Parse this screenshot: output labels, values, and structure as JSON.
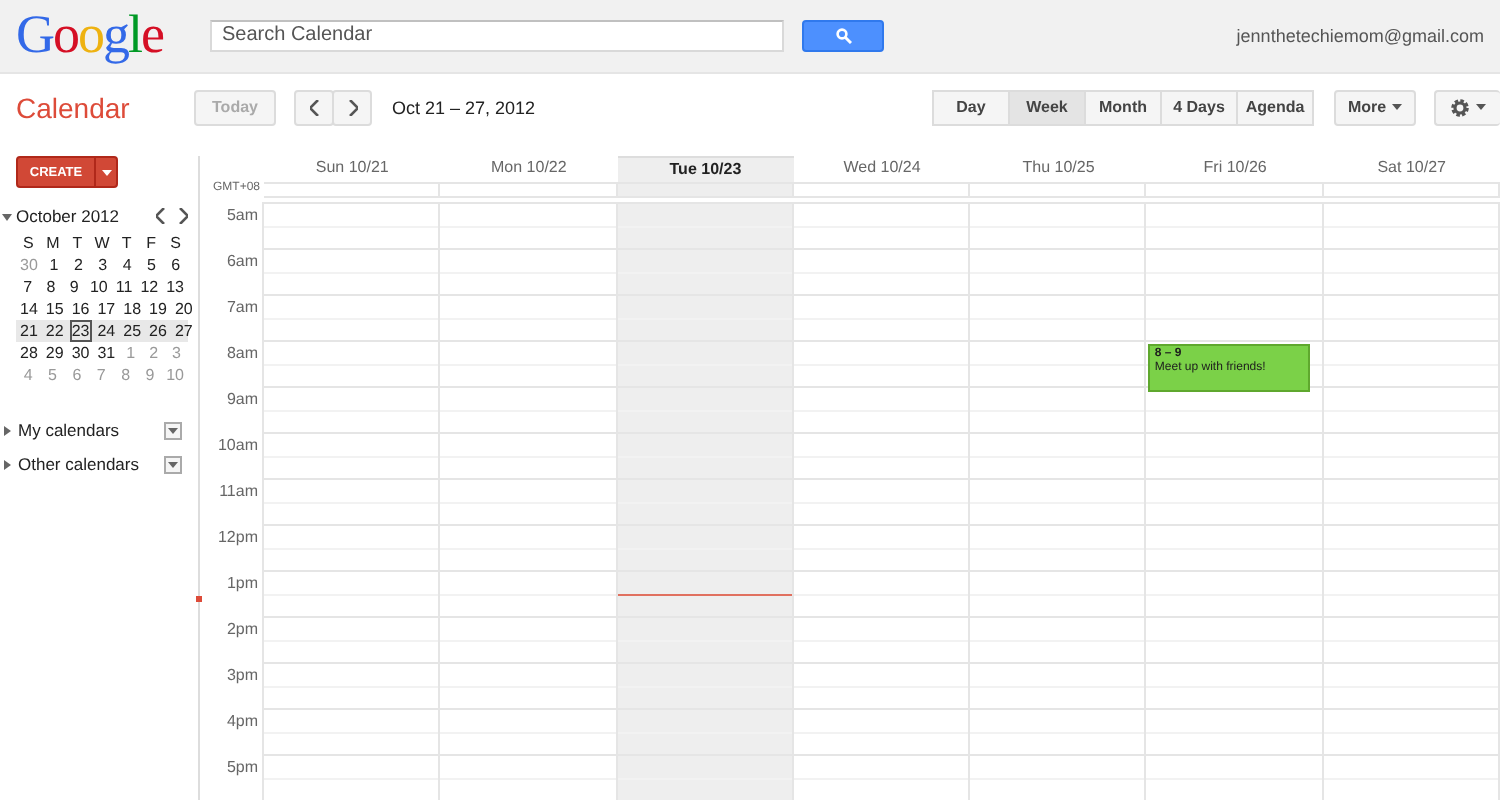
{
  "header": {
    "logo": "Google",
    "search": {
      "placeholder": "Search Calendar"
    },
    "account": "jennthetechiemom@gmail.com"
  },
  "toolbar": {
    "app_title": "Calendar",
    "today_button": {
      "label": "Today",
      "disabled": true
    },
    "date_range": "Oct 21 – 27, 2012",
    "views": [
      {
        "label": "Day",
        "selected": false
      },
      {
        "label": "Week",
        "selected": true
      },
      {
        "label": "Month",
        "selected": false
      },
      {
        "label": "4 Days",
        "selected": false
      },
      {
        "label": "Agenda",
        "selected": false
      }
    ],
    "more_button": "More"
  },
  "sidebar": {
    "create_button": "CREATE",
    "mini_calendar": {
      "title": "October 2012",
      "weekdays": [
        "S",
        "M",
        "T",
        "W",
        "T",
        "F",
        "S"
      ],
      "weeks": [
        {
          "selected": false,
          "days": [
            {
              "label": "30",
              "other_month": true,
              "today": false
            },
            {
              "label": "1",
              "other_month": false,
              "today": false
            },
            {
              "label": "2",
              "other_month": false,
              "today": false
            },
            {
              "label": "3",
              "other_month": false,
              "today": false
            },
            {
              "label": "4",
              "other_month": false,
              "today": false
            },
            {
              "label": "5",
              "other_month": false,
              "today": false
            },
            {
              "label": "6",
              "other_month": false,
              "today": false
            }
          ]
        },
        {
          "selected": false,
          "days": [
            {
              "label": "7",
              "other_month": false,
              "today": false
            },
            {
              "label": "8",
              "other_month": false,
              "today": false
            },
            {
              "label": "9",
              "other_month": false,
              "today": false
            },
            {
              "label": "10",
              "other_month": false,
              "today": false
            },
            {
              "label": "11",
              "other_month": false,
              "today": false
            },
            {
              "label": "12",
              "other_month": false,
              "today": false
            },
            {
              "label": "13",
              "other_month": false,
              "today": false
            }
          ]
        },
        {
          "selected": false,
          "days": [
            {
              "label": "14",
              "other_month": false,
              "today": false
            },
            {
              "label": "15",
              "other_month": false,
              "today": false
            },
            {
              "label": "16",
              "other_month": false,
              "today": false
            },
            {
              "label": "17",
              "other_month": false,
              "today": false
            },
            {
              "label": "18",
              "other_month": false,
              "today": false
            },
            {
              "label": "19",
              "other_month": false,
              "today": false
            },
            {
              "label": "20",
              "other_month": false,
              "today": false
            }
          ]
        },
        {
          "selected": true,
          "days": [
            {
              "label": "21",
              "other_month": false,
              "today": false
            },
            {
              "label": "22",
              "other_month": false,
              "today": false
            },
            {
              "label": "23",
              "other_month": false,
              "today": true
            },
            {
              "label": "24",
              "other_month": false,
              "today": false
            },
            {
              "label": "25",
              "other_month": false,
              "today": false
            },
            {
              "label": "26",
              "other_month": false,
              "today": false
            },
            {
              "label": "27",
              "other_month": false,
              "today": false
            }
          ]
        },
        {
          "selected": false,
          "days": [
            {
              "label": "28",
              "other_month": false,
              "today": false
            },
            {
              "label": "29",
              "other_month": false,
              "today": false
            },
            {
              "label": "30",
              "other_month": false,
              "today": false
            },
            {
              "label": "31",
              "other_month": false,
              "today": false
            },
            {
              "label": "1",
              "other_month": true,
              "today": false
            },
            {
              "label": "2",
              "other_month": true,
              "today": false
            },
            {
              "label": "3",
              "other_month": true,
              "today": false
            }
          ]
        },
        {
          "selected": false,
          "days": [
            {
              "label": "4",
              "other_month": true,
              "today": false
            },
            {
              "label": "5",
              "other_month": true,
              "today": false
            },
            {
              "label": "6",
              "other_month": true,
              "today": false
            },
            {
              "label": "7",
              "other_month": true,
              "today": false
            },
            {
              "label": "8",
              "other_month": true,
              "today": false
            },
            {
              "label": "9",
              "other_month": true,
              "today": false
            },
            {
              "label": "10",
              "other_month": true,
              "today": false
            }
          ]
        }
      ]
    },
    "sections": [
      {
        "label": "My calendars",
        "expanded": false
      },
      {
        "label": "Other calendars",
        "expanded": false
      }
    ]
  },
  "week": {
    "timezone": "GMT+08",
    "days": [
      {
        "label": "Sun 10/21",
        "current": false
      },
      {
        "label": "Mon 10/22",
        "current": false
      },
      {
        "label": "Tue 10/23",
        "current": true
      },
      {
        "label": "Wed 10/24",
        "current": false
      },
      {
        "label": "Thu 10/25",
        "current": false
      },
      {
        "label": "Fri 10/26",
        "current": false,
        "events": [
          {
            "time": "8 – 9",
            "title": "Meet up with friends!",
            "color": "#7bd148"
          }
        ]
      },
      {
        "label": "Sat 10/27",
        "current": false
      }
    ],
    "hours": [
      {
        "label": "5am",
        "now": false
      },
      {
        "label": "6am",
        "now": false
      },
      {
        "label": "7am",
        "now": false
      },
      {
        "label": "8am",
        "now": false,
        "event_start": true
      },
      {
        "label": "9am",
        "now": false
      },
      {
        "label": "10am",
        "now": false
      },
      {
        "label": "11am",
        "now": false
      },
      {
        "label": "12pm",
        "now": false
      },
      {
        "label": "1pm",
        "now": true
      },
      {
        "label": "2pm",
        "now": false
      },
      {
        "label": "3pm",
        "now": false
      },
      {
        "label": "4pm",
        "now": false
      },
      {
        "label": "5pm",
        "now": false
      }
    ]
  }
}
